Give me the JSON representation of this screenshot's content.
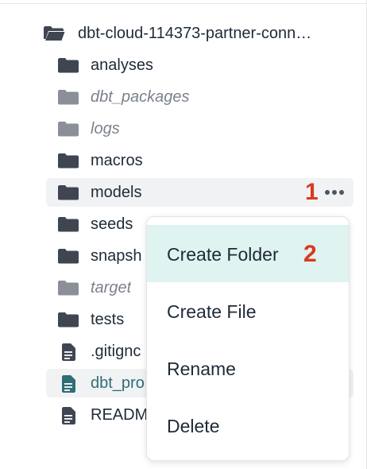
{
  "file_tree": {
    "root": {
      "label": "dbt-cloud-114373-partner-conn…",
      "icon": "folder-open-icon"
    },
    "items": [
      {
        "label": "analyses",
        "icon": "folder-icon",
        "style": "normal"
      },
      {
        "label": "dbt_packages",
        "icon": "folder-icon",
        "style": "italic"
      },
      {
        "label": "logs",
        "icon": "folder-icon",
        "style": "italic"
      },
      {
        "label": "macros",
        "icon": "folder-icon",
        "style": "normal"
      },
      {
        "label": "models",
        "icon": "folder-icon",
        "style": "normal"
      },
      {
        "label": "seeds",
        "icon": "folder-icon",
        "style": "normal"
      },
      {
        "label": "snapsh",
        "icon": "folder-icon",
        "style": "normal"
      },
      {
        "label": "target",
        "icon": "folder-icon",
        "style": "italic"
      },
      {
        "label": "tests",
        "icon": "folder-icon",
        "style": "normal"
      },
      {
        "label": ".gitignc",
        "icon": "file-icon",
        "style": "normal"
      },
      {
        "label": "dbt_pro",
        "icon": "file-icon",
        "style": "accent"
      },
      {
        "label": "READM",
        "icon": "file-icon",
        "style": "normal"
      }
    ],
    "more_icon": "more-horizontal-icon"
  },
  "context_menu": {
    "items": [
      {
        "label": "Create Folder"
      },
      {
        "label": "Create File"
      },
      {
        "label": "Rename"
      },
      {
        "label": "Delete"
      }
    ]
  },
  "annotations": {
    "step1": "1",
    "step2": "2"
  },
  "colors": {
    "folder_dark": "#3f4652",
    "folder_muted": "#8a8f98",
    "file_accent": "#2f6e74",
    "menu_active_bg": "#dff3f1",
    "annotation": "#d93a1f"
  }
}
